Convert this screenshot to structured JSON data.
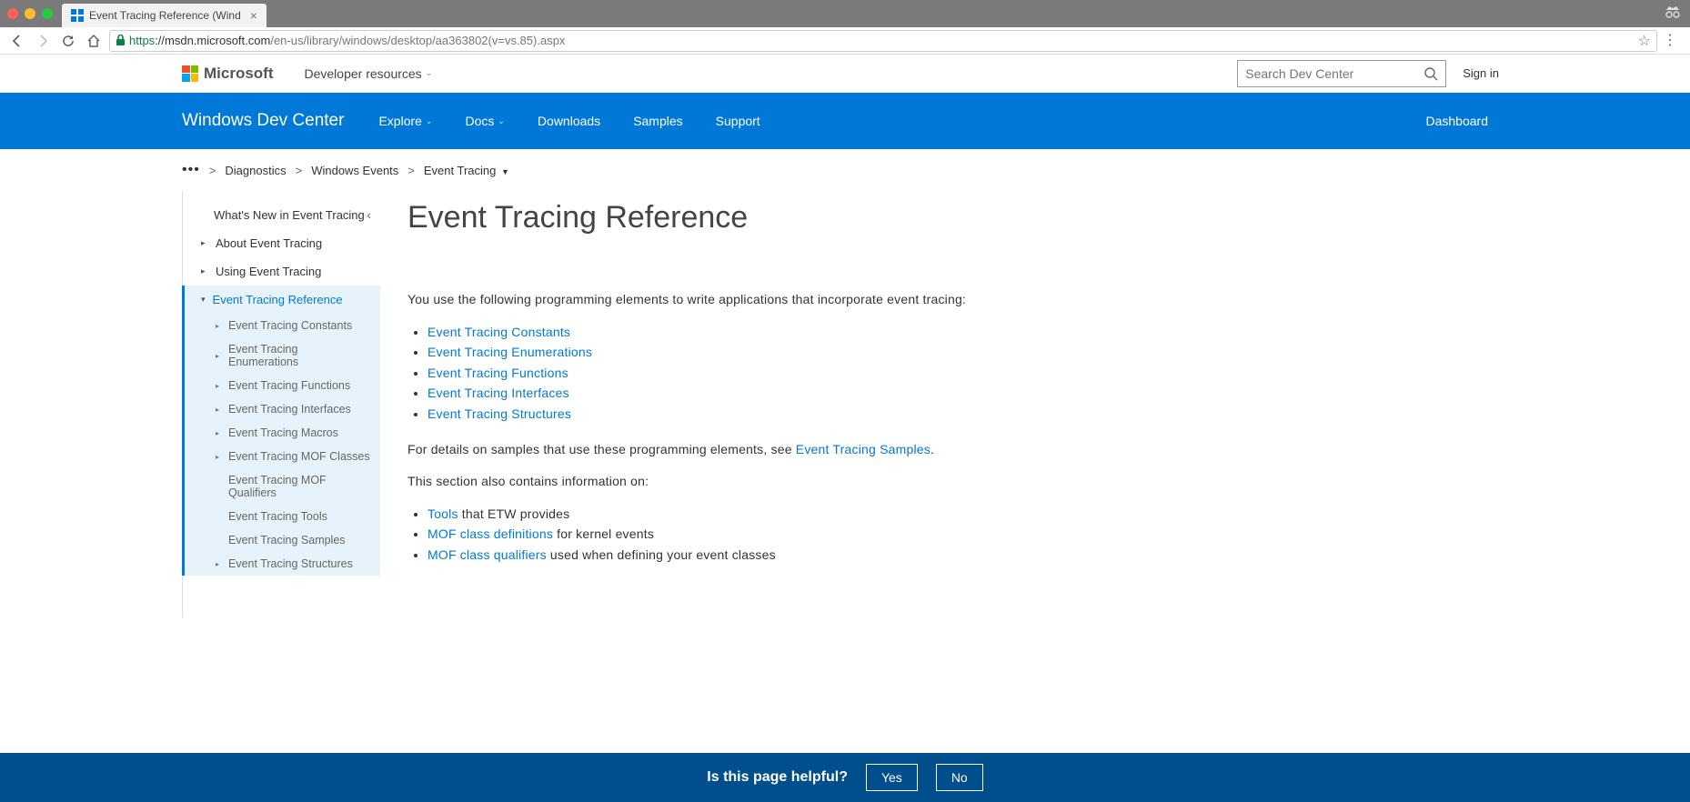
{
  "browser": {
    "tab_title": "Event Tracing Reference (Wind",
    "url_https": "https",
    "url_domain": "://msdn.microsoft.com",
    "url_path": "/en-us/library/windows/desktop/aa363802(v=vs.85).aspx"
  },
  "header": {
    "microsoft": "Microsoft",
    "dev_resources": "Developer resources",
    "search_placeholder": "Search Dev Center",
    "signin": "Sign in"
  },
  "nav": {
    "title": "Windows Dev Center",
    "items": [
      "Explore",
      "Docs",
      "Downloads",
      "Samples",
      "Support"
    ],
    "dashboard": "Dashboard"
  },
  "breadcrumb": {
    "items": [
      "Diagnostics",
      "Windows Events",
      "Event Tracing"
    ]
  },
  "sidebar": {
    "whats_new": "What's New in Event Tracing",
    "about": "About Event Tracing",
    "using": "Using Event Tracing",
    "ref": "Event Tracing Reference",
    "sub": [
      "Event Tracing Constants",
      "Event Tracing Enumerations",
      "Event Tracing Functions",
      "Event Tracing Interfaces",
      "Event Tracing Macros",
      "Event Tracing MOF Classes",
      "Event Tracing MOF Qualifiers",
      "Event Tracing Tools",
      "Event Tracing Samples",
      "Event Tracing Structures"
    ]
  },
  "page": {
    "title": "Event Tracing Reference",
    "intro": "You use the following programming elements to write applications that incorporate event tracing:",
    "links1": [
      "Event Tracing Constants",
      "Event Tracing Enumerations",
      "Event Tracing Functions",
      "Event Tracing Interfaces",
      "Event Tracing Structures"
    ],
    "para2_pre": "For details on samples that use these programming elements, see ",
    "para2_link": "Event Tracing Samples",
    "para2_post": ".",
    "para3": "This section also contains information on:",
    "bullets2": [
      {
        "link": "Tools",
        "rest": " that ETW provides"
      },
      {
        "link": "MOF class definitions",
        "rest": " for kernel events"
      },
      {
        "link": "MOF class qualifiers",
        "rest": " used when defining your event classes"
      }
    ]
  },
  "footer": {
    "prompt": "Is this page helpful?",
    "yes": "Yes",
    "no": "No"
  }
}
